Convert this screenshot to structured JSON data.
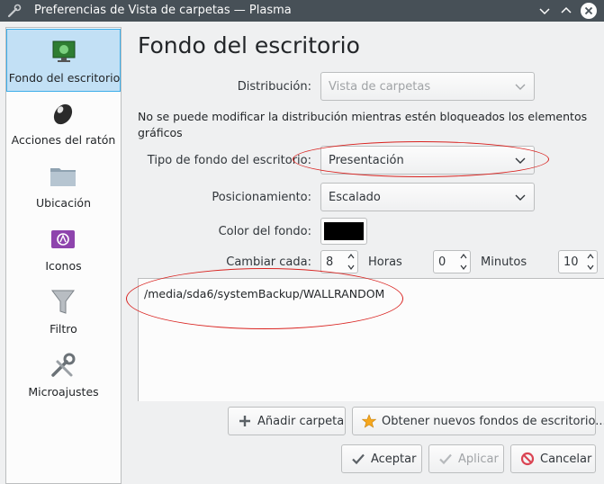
{
  "window": {
    "title": "Preferencias de Vista de carpetas — Plasma"
  },
  "sidebar": {
    "items": [
      {
        "label": "Fondo del escritorio",
        "icon": "wallpaper-icon",
        "active": true
      },
      {
        "label": "Acciones del ratón",
        "icon": "mouse-icon"
      },
      {
        "label": "Ubicación",
        "icon": "folder-icon"
      },
      {
        "label": "Iconos",
        "icon": "icons-icon"
      },
      {
        "label": "Filtro",
        "icon": "filter-icon"
      },
      {
        "label": "Microajustes",
        "icon": "tools-icon"
      }
    ]
  },
  "main": {
    "title": "Fondo del escritorio",
    "layout_label": "Distribución:",
    "layout_value": "Vista de carpetas",
    "locked_note": "No se puede modificar la distribución mientras estén bloqueados los elementos gráficos",
    "bg_type_label": "Tipo de fondo del escritorio:",
    "bg_type_value": "Presentación",
    "positioning_label": "Posicionamiento:",
    "positioning_value": "Escalado",
    "bg_color_label": "Color del fondo:",
    "bg_color_value": "#000000",
    "change_every_label": "Cambiar cada:",
    "hours_value": "8",
    "hours_label": "Horas",
    "minutes_value": "0",
    "minutes_label": "Minutos",
    "seconds_value": "10",
    "folders": [
      "/media/sda6/systemBackup/WALLRANDOM"
    ],
    "add_folder_label": "Añadir carpeta",
    "get_new_label": "Obtener nuevos fondos de escritorio..."
  },
  "footer": {
    "ok_label": "Aceptar",
    "apply_label": "Aplicar",
    "cancel_label": "Cancelar"
  },
  "colors": {
    "titlebar": "#475057",
    "accent": "#3daee9",
    "annotation": "#d9221f"
  }
}
